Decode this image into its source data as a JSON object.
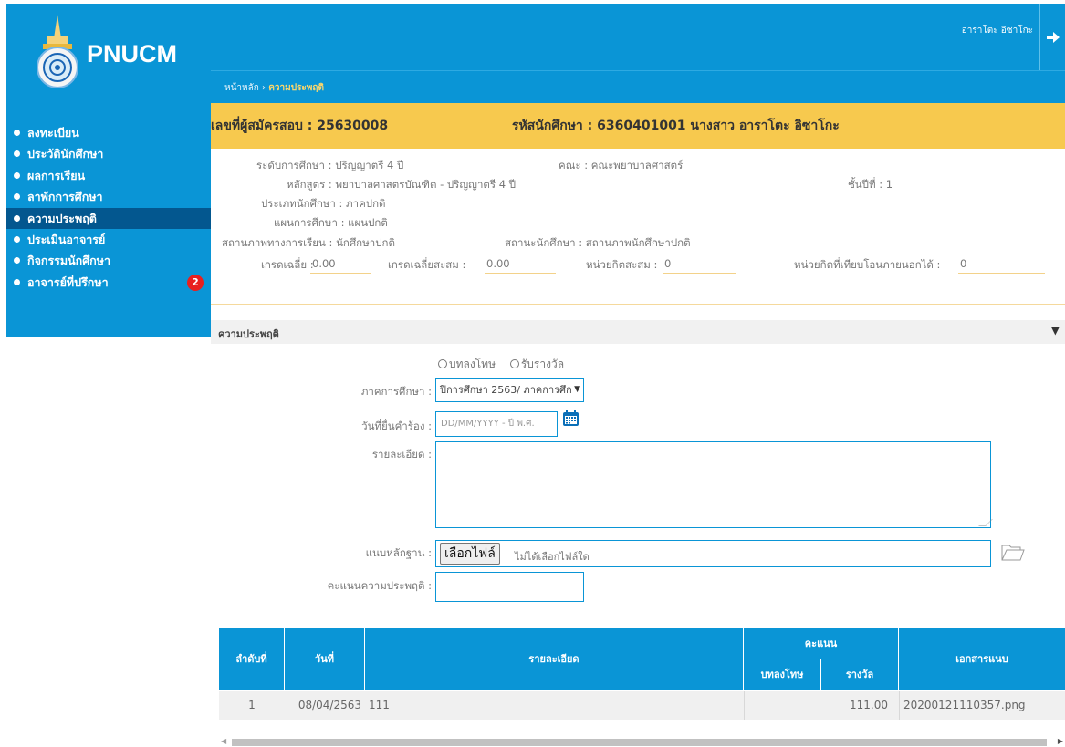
{
  "app": {
    "logo_text": "PNUCM",
    "user_name": "อาราโตะ อิซาโกะ"
  },
  "breadcrumb": {
    "home": "หน้าหลัก",
    "separator": "›",
    "current": "ความประพฤติ"
  },
  "sidebar": {
    "items": [
      {
        "label": "ลงทะเบียน"
      },
      {
        "label": "ประวัตินักศึกษา"
      },
      {
        "label": "ผลการเรียน"
      },
      {
        "label": "ลาพักการศึกษา"
      },
      {
        "label": "ความประพฤติ"
      },
      {
        "label": "ประเมินอาจารย์"
      },
      {
        "label": "กิจกรรมนักศึกษา"
      },
      {
        "label": "อาจารย์ที่ปรึกษา",
        "badge": "2"
      }
    ]
  },
  "student": {
    "applicant": "เลขที่ผู้สมัครสอบ : 25630008",
    "student_id": "รหัสนักศึกษา : 6360401001 นางสาว อาราโตะ อิซาโกะ",
    "level": "ระดับการศึกษา : ปริญญาตรี 4 ปี",
    "faculty": "คณะ : คณะพยาบาลศาสตร์",
    "curriculum": "หลักสูตร : พยาบาลศาสตรบัณฑิต - ปริญญาตรี 4 ปี",
    "year": "ชั้นปีที่ : 1",
    "type": "ประเภทนักศึกษา : ภาคปกติ",
    "plan": "แผนการศึกษา : แผนปกติ",
    "study_status": "สถานภาพทางการเรียน : นักศึกษาปกติ",
    "student_status": "สถานะนักศึกษา : สถานภาพนักศึกษาปกติ",
    "gpa_label": "เกรดเฉลี่ย :",
    "gpa": "0.00",
    "gpax_label": "เกรดเฉลี่ยสะสม :",
    "gpax": "0.00",
    "credits_label": "หน่วยกิตสะสม :",
    "credits": "0",
    "transfer_label": "หน่วยกิตที่เทียบโอนภายนอกได้ :",
    "transfer": "0"
  },
  "section": {
    "title": "ความประพฤติ",
    "toggle": "▼"
  },
  "form": {
    "radio_punish": "บทลงโทษ",
    "radio_award": "รับรางวัล",
    "semester_label": "ภาคการศึกษา :",
    "semester_value": "ปีการศึกษา 2563/ ภาคการศึก",
    "date_label": "วันที่ยื่นคำร้อง :",
    "date_placeholder": "DD/MM/YYYY - ปี พ.ศ.",
    "detail_label": "รายละเอียด :",
    "evidence_label": "แนบหลักฐาน :",
    "file_button": "เลือกไฟล์",
    "file_status": "ไม่ได้เลือกไฟล์ใด",
    "score_label": "คะแนนความประพฤติ :"
  },
  "table": {
    "headers": {
      "no": "ลำดับที่",
      "date": "วันที่",
      "detail": "รายละเอียด",
      "score": "คะแนน",
      "punish": "บทลงโทษ",
      "award": "รางวัล",
      "attachment": "เอกสารแนบ"
    },
    "rows": [
      {
        "no": "1",
        "date": "08/04/2563",
        "detail": "111",
        "punish": "",
        "award": "111.00",
        "attachment": "20200121110357.png"
      }
    ]
  },
  "colors": {
    "primary": "#0a95d6",
    "active_menu": "#03578f",
    "header_yellow": "#f7c94e",
    "badge_red": "#e8201f"
  }
}
